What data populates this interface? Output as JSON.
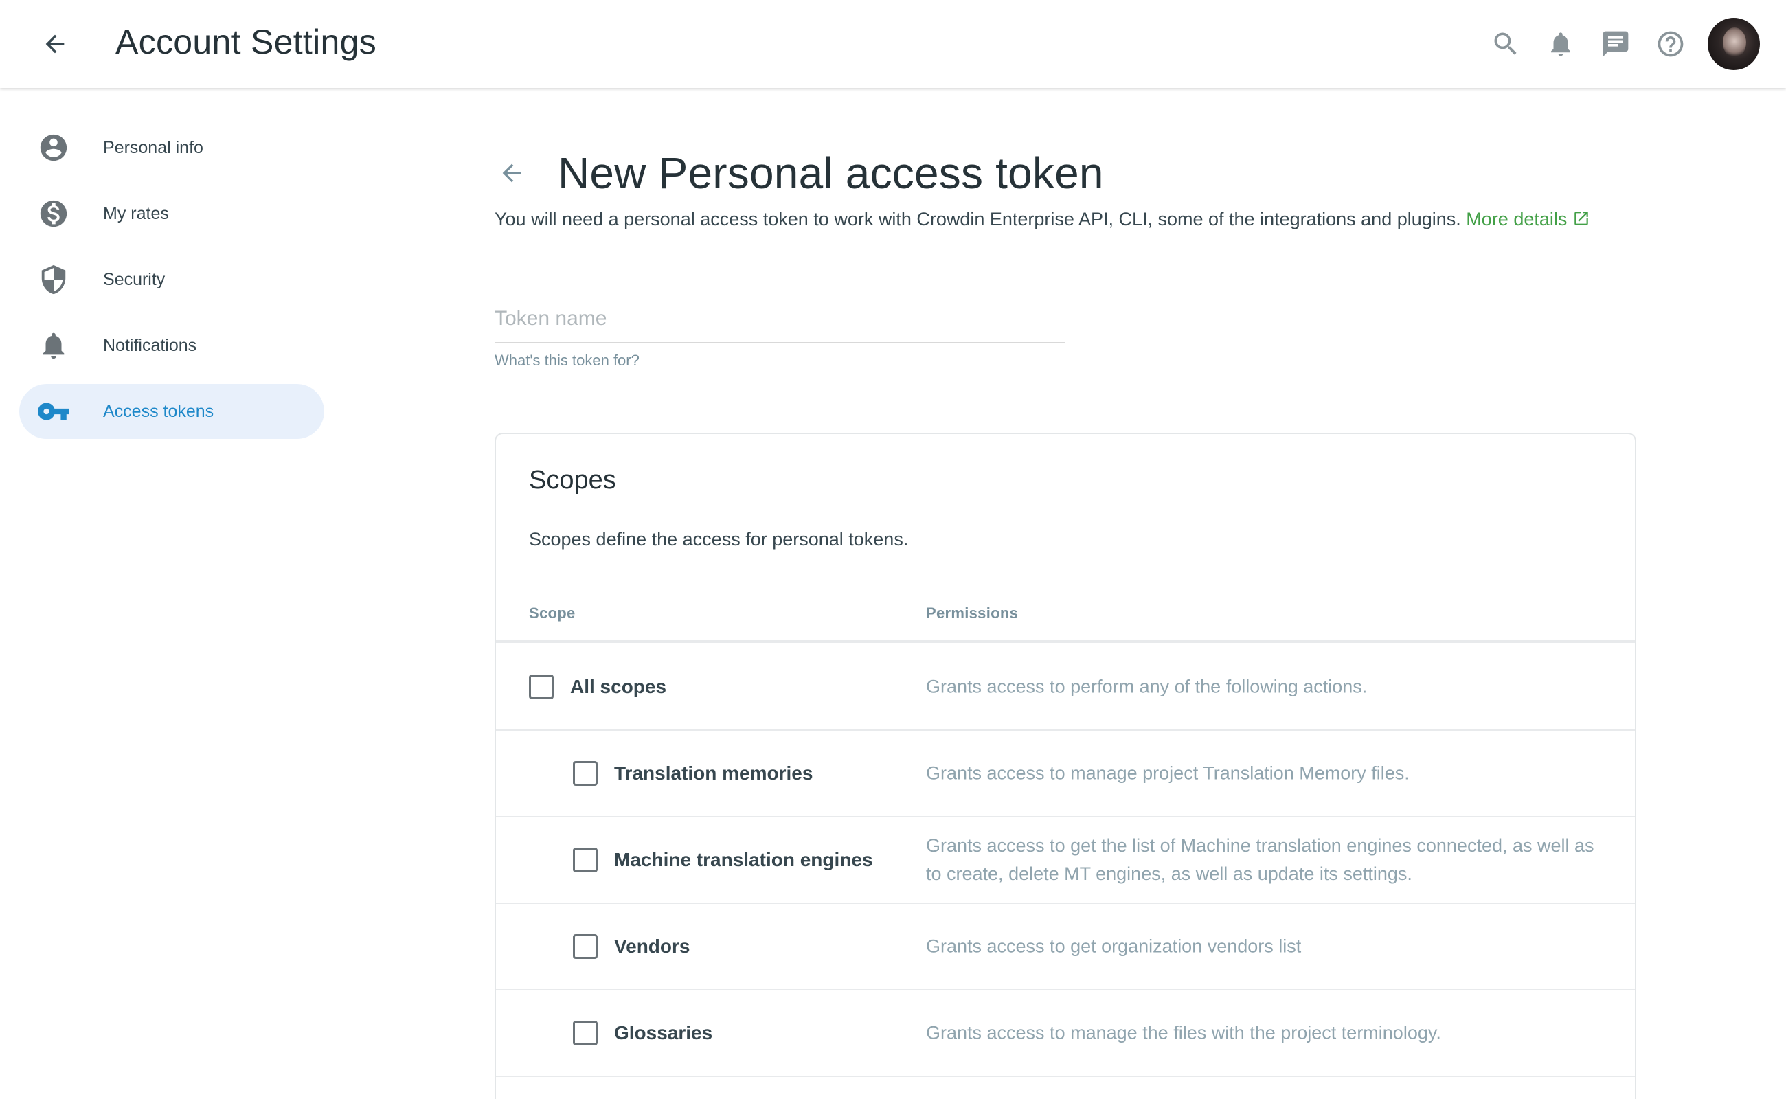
{
  "header": {
    "title": "Account Settings"
  },
  "sidebar": {
    "items": [
      {
        "label": "Personal info",
        "icon": "account-circle-icon"
      },
      {
        "label": "My rates",
        "icon": "dollar-circle-icon"
      },
      {
        "label": "Security",
        "icon": "shield-icon"
      },
      {
        "label": "Notifications",
        "icon": "bell-icon"
      },
      {
        "label": "Access tokens",
        "icon": "key-icon",
        "active": true
      }
    ]
  },
  "main": {
    "title": "New Personal access token",
    "description": "You will need a personal access token to work with Crowdin Enterprise API, CLI, some of the integrations and plugins.",
    "more_details": "More details",
    "token_field": {
      "placeholder": "Token name",
      "value": "",
      "hint": "What's this token for?"
    },
    "scopes": {
      "title": "Scopes",
      "description": "Scopes define the access for personal tokens.",
      "columns": [
        "Scope",
        "Permissions"
      ],
      "rows": [
        {
          "name": "All scopes",
          "permission": "Grants access to perform any of the following actions.",
          "checked": false
        },
        {
          "name": "Translation memories",
          "permission": "Grants access to manage project Translation Memory files.",
          "checked": false
        },
        {
          "name": "Machine translation engines",
          "permission": "Grants access to get the list of Machine translation engines connected, as well as to create, delete MT engines, as well as update its settings.",
          "checked": false
        },
        {
          "name": "Vendors",
          "permission": "Grants access to get organization vendors list",
          "checked": false
        },
        {
          "name": "Glossaries",
          "permission": "Grants access to manage the files with the project terminology.",
          "checked": false
        }
      ]
    }
  },
  "colors": {
    "accent_blue": "#1e88c9",
    "active_bg": "#e8f0fb",
    "link_green": "#43a047"
  }
}
